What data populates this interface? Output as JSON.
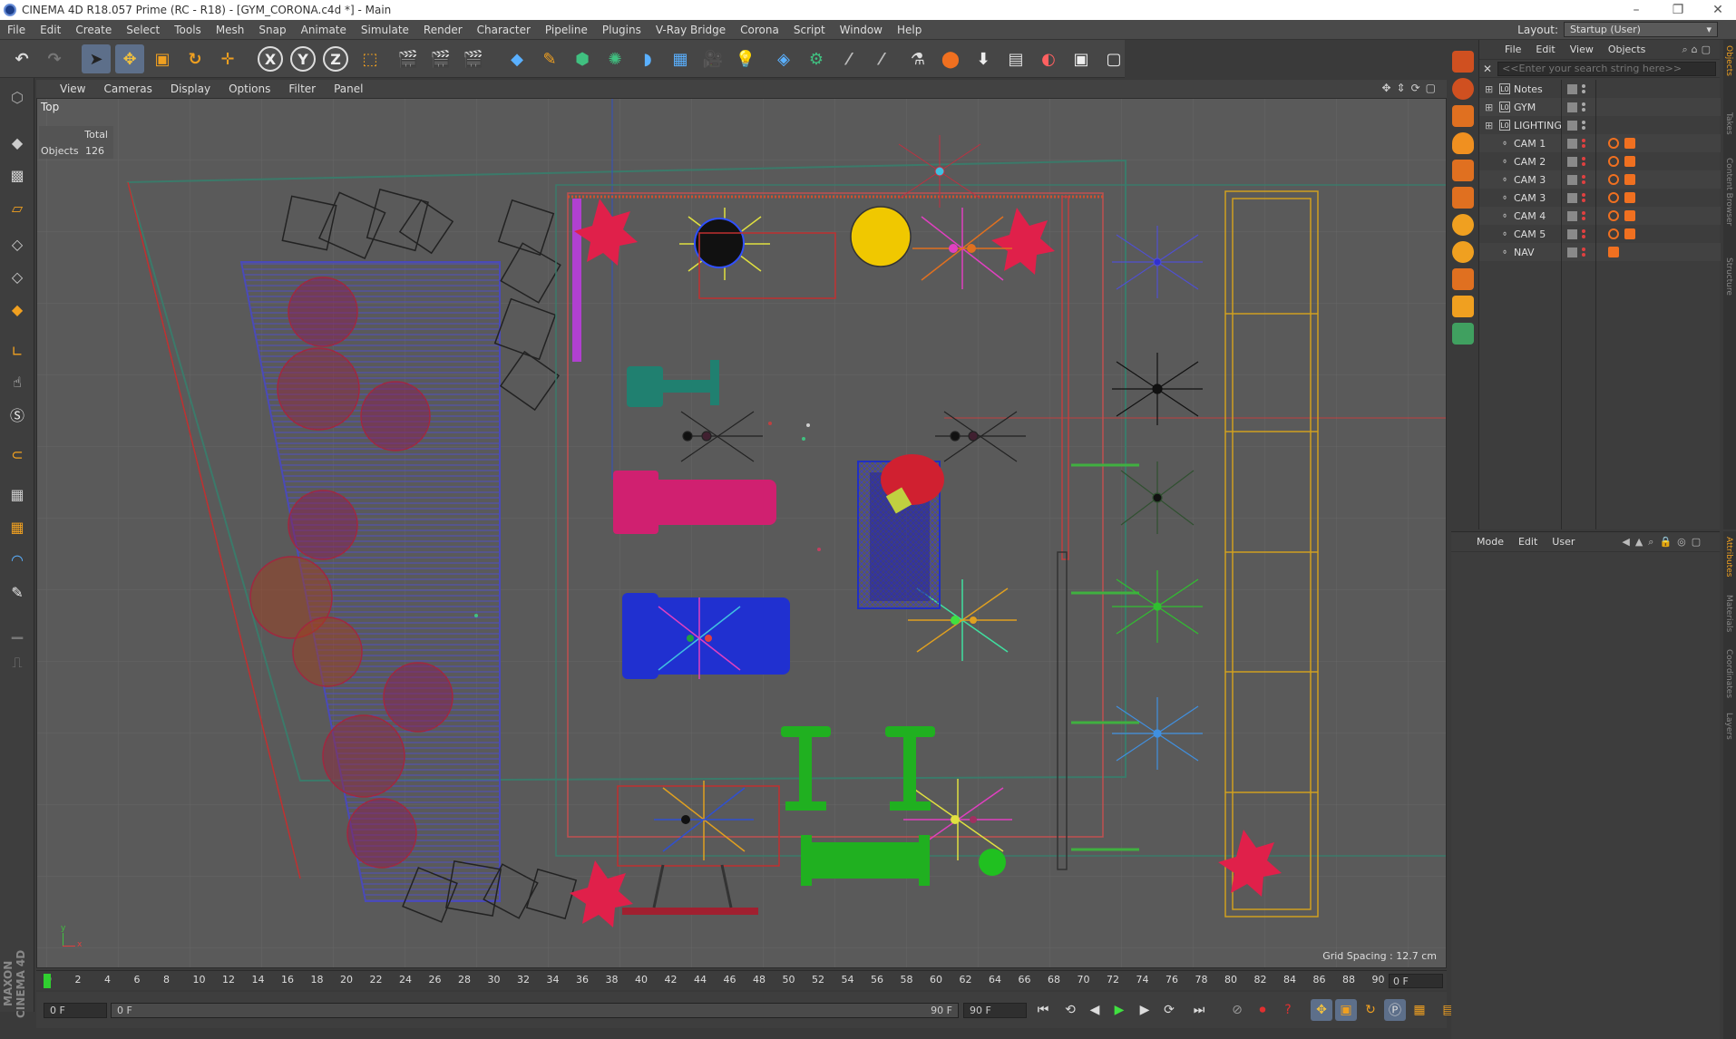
{
  "window": {
    "title": "CINEMA 4D R18.057 Prime (RC - R18) - [GYM_CORONA.c4d *] - Main"
  },
  "menubar": [
    "File",
    "Edit",
    "Create",
    "Select",
    "Tools",
    "Mesh",
    "Snap",
    "Animate",
    "Simulate",
    "Render",
    "Character",
    "Pipeline",
    "Plugins",
    "V-Ray Bridge",
    "Corona",
    "Script",
    "Window",
    "Help"
  ],
  "layout": {
    "label": "Layout:",
    "value": "Startup (User)"
  },
  "toolbar": {
    "axis_x": "X",
    "axis_y": "Y",
    "axis_z": "Z"
  },
  "viewport": {
    "menu": [
      "View",
      "Cameras",
      "Display",
      "Options",
      "Filter",
      "Panel"
    ],
    "label": "Top",
    "stats_header": "Total",
    "stats_label": "Objects",
    "stats_value": "126",
    "grid_spacing": "Grid Spacing : 12.7 cm",
    "axis_y": "y",
    "axis_x": "x"
  },
  "timeline": {
    "ticks": [
      "0",
      "2",
      "4",
      "6",
      "8",
      "10",
      "12",
      "14",
      "16",
      "18",
      "20",
      "22",
      "24",
      "26",
      "28",
      "30",
      "32",
      "34",
      "36",
      "38",
      "40",
      "42",
      "44",
      "46",
      "48",
      "50",
      "52",
      "54",
      "56",
      "58",
      "60",
      "62",
      "64",
      "66",
      "68",
      "70",
      "72",
      "74",
      "76",
      "78",
      "80",
      "82",
      "84",
      "86",
      "88",
      "90"
    ],
    "current_frame": "0 F"
  },
  "playbar": {
    "start": "0 F",
    "range_start": "0 F",
    "range_end": "90 F",
    "end": "90 F"
  },
  "object_manager": {
    "menu": [
      "File",
      "Edit",
      "View",
      "Objects"
    ],
    "search_placeholder": "<<Enter your search string here>>",
    "objects": [
      {
        "name": "Notes",
        "type": "layer"
      },
      {
        "name": "GYM",
        "type": "layer"
      },
      {
        "name": "LIGHTING",
        "type": "layer"
      },
      {
        "name": "CAM 1",
        "type": "camera"
      },
      {
        "name": "CAM 2",
        "type": "camera"
      },
      {
        "name": "CAM 3",
        "type": "camera"
      },
      {
        "name": "CAM 3",
        "type": "camera"
      },
      {
        "name": "CAM 4",
        "type": "camera"
      },
      {
        "name": "CAM 5",
        "type": "camera"
      },
      {
        "name": "NAV",
        "type": "null"
      }
    ],
    "side_tabs": [
      "Objects",
      "Takes",
      "Content Browser",
      "Structure"
    ]
  },
  "attribute_manager": {
    "menu": [
      "Mode",
      "Edit",
      "User"
    ],
    "side_tabs": [
      "Attributes",
      "Materials",
      "Coordinates",
      "Layers"
    ]
  },
  "branding": "MAXON CINEMA 4D",
  "colors": {
    "accent": "#5d6f8a",
    "background": "#5a5a5a"
  }
}
